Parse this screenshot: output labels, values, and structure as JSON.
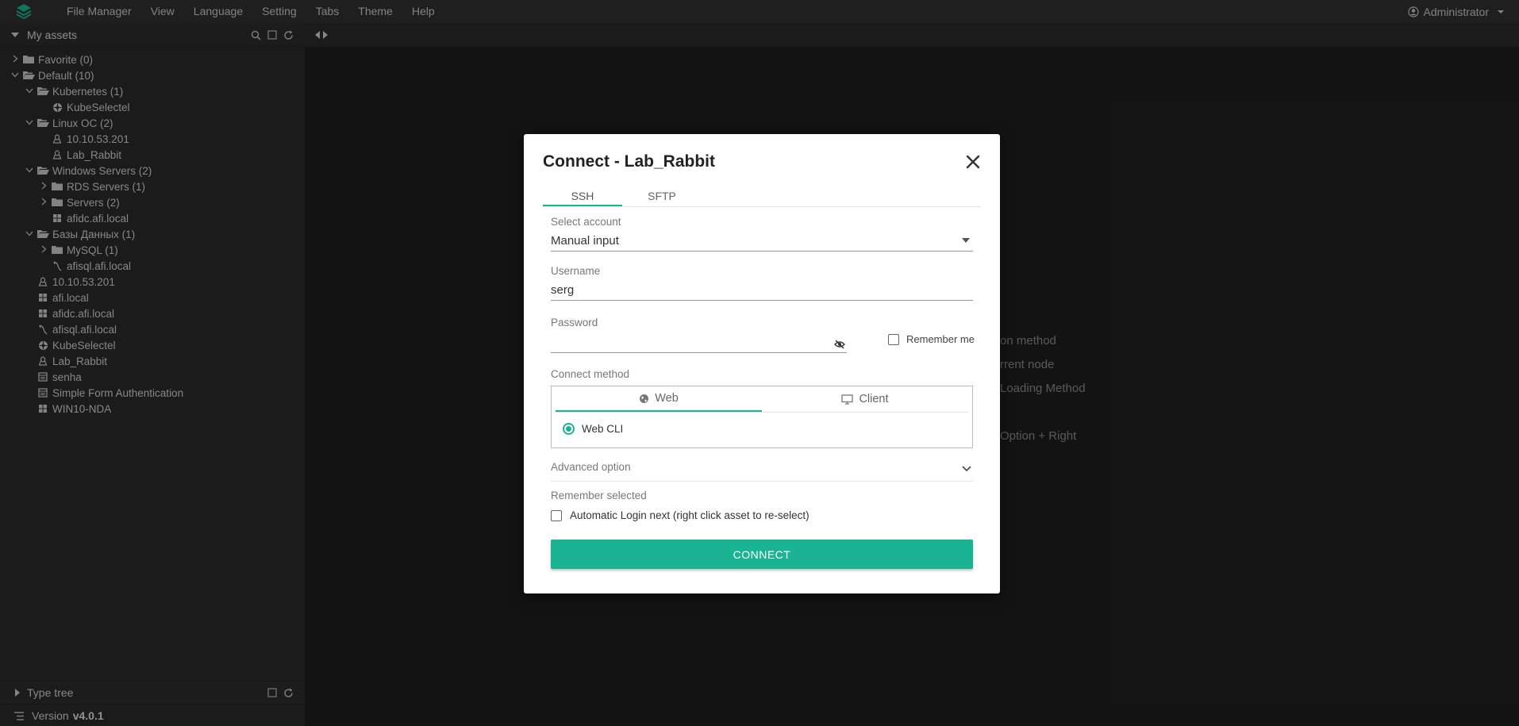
{
  "menubar": {
    "items": [
      "File Manager",
      "View",
      "Language",
      "Setting",
      "Tabs",
      "Theme",
      "Help"
    ],
    "user": "Administrator"
  },
  "sidebar": {
    "title": "My assets",
    "tree": [
      {
        "label": "Favorite (0)",
        "depth": 0,
        "toggle": "collapsed",
        "icon": "folder-icon"
      },
      {
        "label": "Default (10)",
        "depth": 0,
        "toggle": "expanded",
        "icon": "folder-open-icon"
      },
      {
        "label": "Kubernetes (1)",
        "depth": 1,
        "toggle": "expanded",
        "icon": "folder-open-icon"
      },
      {
        "label": "KubeSelectel",
        "depth": 2,
        "toggle": "none",
        "icon": "kubernetes-icon"
      },
      {
        "label": "Linux OC (2)",
        "depth": 1,
        "toggle": "expanded",
        "icon": "folder-open-icon"
      },
      {
        "label": "10.10.53.201",
        "depth": 2,
        "toggle": "none",
        "icon": "linux-icon"
      },
      {
        "label": "Lab_Rabbit",
        "depth": 2,
        "toggle": "none",
        "icon": "linux-icon"
      },
      {
        "label": "Windows Servers (2)",
        "depth": 1,
        "toggle": "expanded",
        "icon": "folder-open-icon"
      },
      {
        "label": "RDS Servers (1)",
        "depth": 2,
        "toggle": "collapsed",
        "icon": "folder-icon"
      },
      {
        "label": "Servers (2)",
        "depth": 2,
        "toggle": "collapsed",
        "icon": "folder-icon"
      },
      {
        "label": "afidc.afi.local",
        "depth": 2,
        "toggle": "none",
        "icon": "windows-icon"
      },
      {
        "label": "Базы Данных (1)",
        "depth": 1,
        "toggle": "expanded",
        "icon": "folder-open-icon"
      },
      {
        "label": "MySQL (1)",
        "depth": 2,
        "toggle": "collapsed",
        "icon": "folder-icon"
      },
      {
        "label": "afisql.afi.local",
        "depth": 2,
        "toggle": "none",
        "icon": "database-icon"
      },
      {
        "label": "10.10.53.201",
        "depth": 1,
        "toggle": "none",
        "icon": "linux-icon"
      },
      {
        "label": "afi.local",
        "depth": 1,
        "toggle": "none",
        "icon": "windows-icon"
      },
      {
        "label": "afidc.afi.local",
        "depth": 1,
        "toggle": "none",
        "icon": "windows-icon"
      },
      {
        "label": "afisql.afi.local",
        "depth": 1,
        "toggle": "none",
        "icon": "database-icon"
      },
      {
        "label": "KubeSelectel",
        "depth": 1,
        "toggle": "none",
        "icon": "kubernetes-icon"
      },
      {
        "label": "Lab_Rabbit",
        "depth": 1,
        "toggle": "none",
        "icon": "linux-icon"
      },
      {
        "label": "senha",
        "depth": 1,
        "toggle": "none",
        "icon": "web-icon"
      },
      {
        "label": "Simple Form Authentication",
        "depth": 1,
        "toggle": "none",
        "icon": "web-icon"
      },
      {
        "label": "WIN10-NDA",
        "depth": 1,
        "toggle": "none",
        "icon": "windows-icon"
      }
    ],
    "type_tree": "Type tree",
    "version_label": "Version",
    "version_value": "v4.0.1"
  },
  "main": {
    "hints": [
      "on method",
      "rrent node",
      "Loading Method",
      "Option + Right"
    ]
  },
  "dialog": {
    "title": "Connect - Lab_Rabbit",
    "tabs": [
      "SSH",
      "SFTP"
    ],
    "account_label": "Select account",
    "account_value": "Manual input",
    "username_label": "Username",
    "username_value": "serg",
    "password_label": "Password",
    "password_value": "",
    "remember_me": "Remember me",
    "connect_method_label": "Connect method",
    "method_tabs": [
      "Web",
      "Client"
    ],
    "method_option": "Web CLI",
    "advanced_option": "Advanced option",
    "remember_selected": "Remember selected",
    "auto_login": "Automatic Login next (right click asset to re-select)",
    "connect_button": "CONNECT",
    "accent_color": "#1ab394"
  }
}
